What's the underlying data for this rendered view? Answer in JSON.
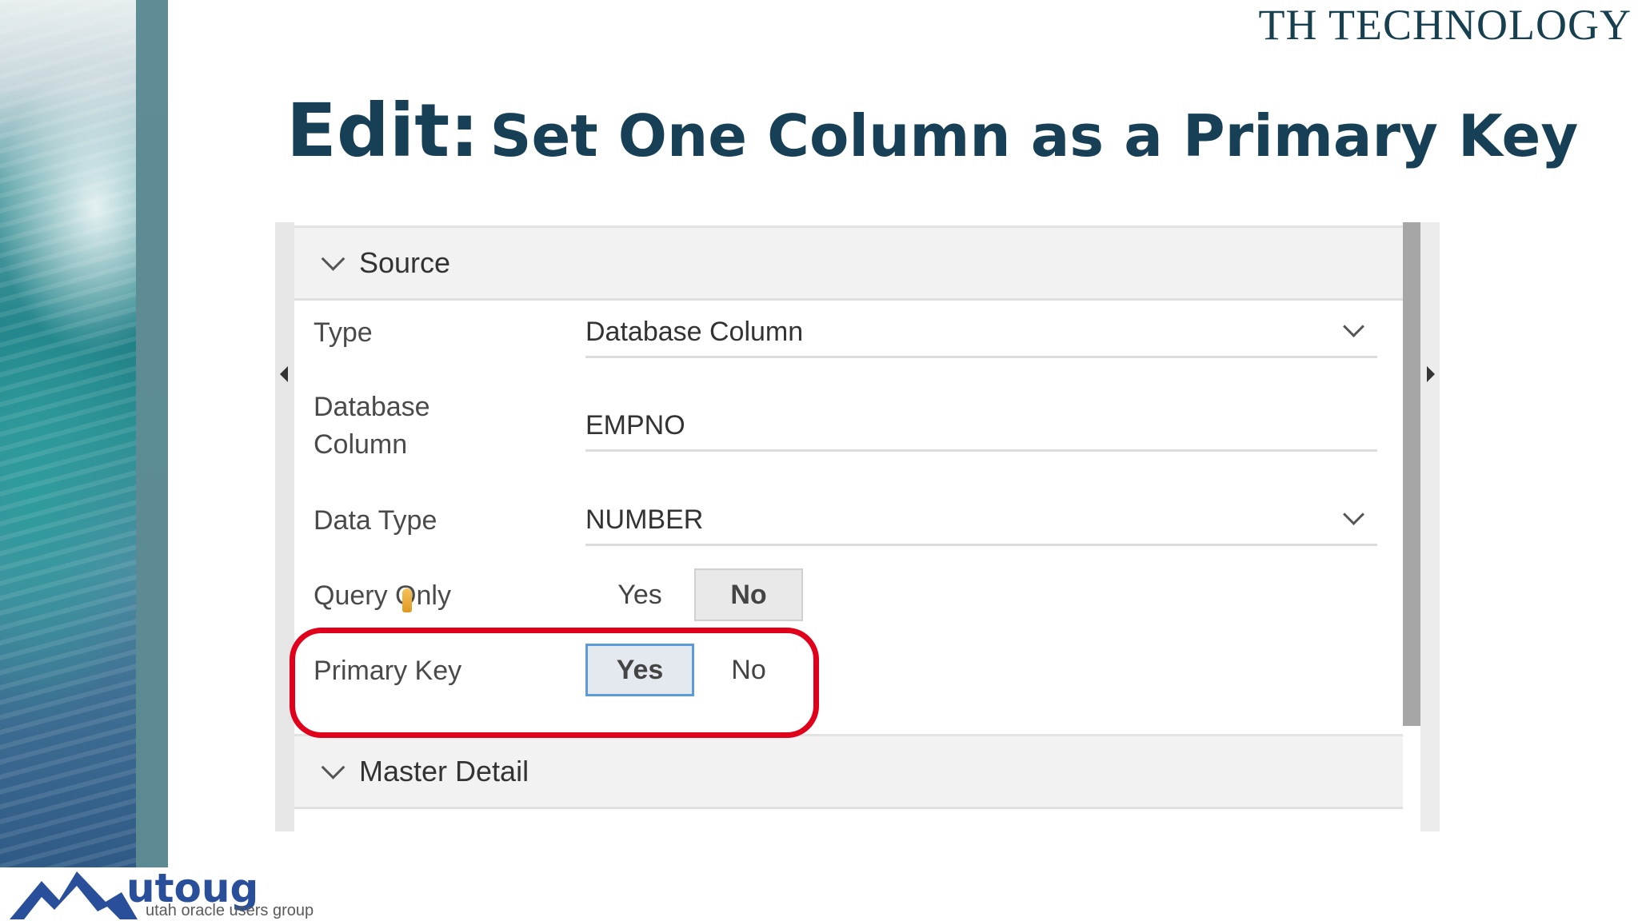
{
  "brand": "TH TECHNOLOGY",
  "slide": {
    "title_lead": "Edit:",
    "title_rest": "Set One Column as a Primary Key"
  },
  "panel": {
    "sections": [
      {
        "label": "Source"
      },
      {
        "label": "Master Detail"
      }
    ],
    "fields": {
      "type": {
        "label": "Type",
        "value": "Database Column"
      },
      "database_column": {
        "label_line1": "Database",
        "label_line2": "Column",
        "value": "EMPNO"
      },
      "data_type": {
        "label": "Data Type",
        "value": "NUMBER"
      },
      "query_only": {
        "label": "Query Only",
        "yes": "Yes",
        "no": "No",
        "selected": "No"
      },
      "primary_key": {
        "label": "Primary Key",
        "yes": "Yes",
        "no": "No",
        "selected": "Yes"
      }
    }
  },
  "logo": {
    "word": "utoug",
    "subtitle": "utah oracle users group"
  },
  "colors": {
    "title": "#173f55",
    "highlight": "#e0001b",
    "selected_border": "#5a9bd8",
    "logo": "#2a4f9a"
  }
}
